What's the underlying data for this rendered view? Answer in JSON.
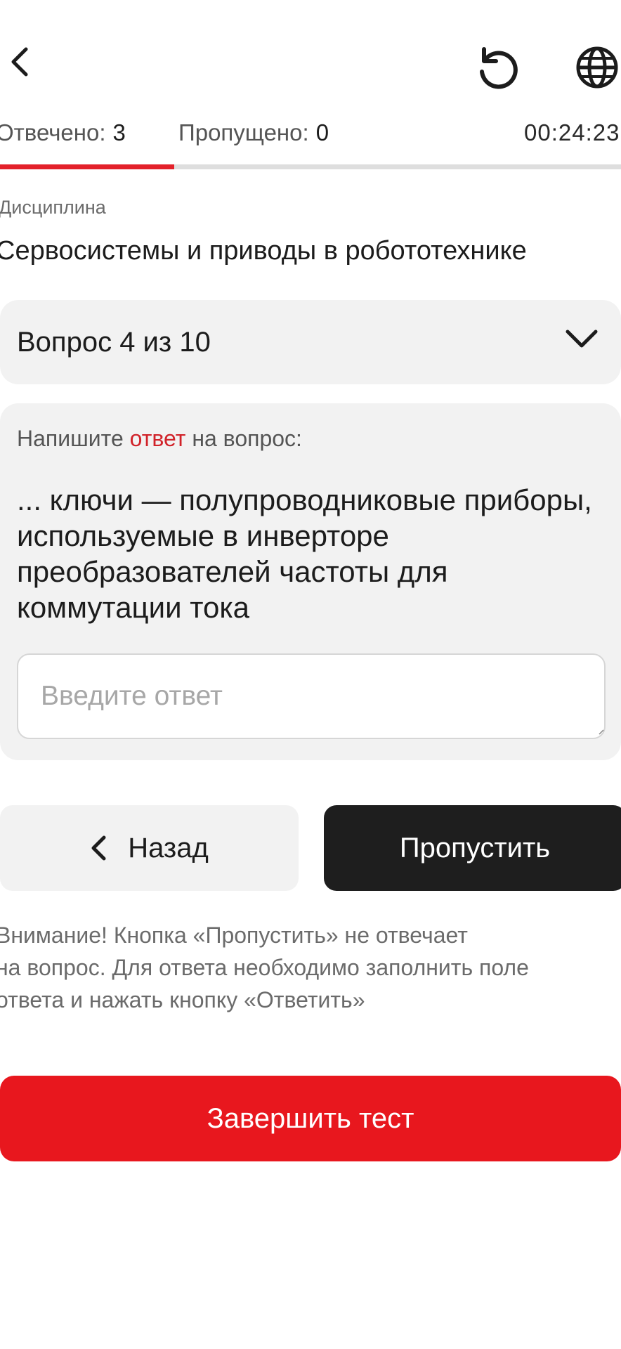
{
  "header": {
    "back_icon": "chevron-left-icon",
    "reset_icon": "reset-icon",
    "language_icon": "globe-icon"
  },
  "stats": {
    "answered_label": "Отвечено:",
    "answered_value": "3",
    "skipped_label": "Пропущено:",
    "skipped_value": "0",
    "timer": "00:24:23",
    "progress_fraction": 0.28
  },
  "discipline": {
    "label": "Дисциплина",
    "title": "Сервосистемы и приводы в робототехнике"
  },
  "question_selector": {
    "label": "Вопрос 4 из 10",
    "icon": "chevron-down-icon"
  },
  "question": {
    "prompt_before": "Напишите ",
    "prompt_accent": "ответ",
    "prompt_after": " на вопрос:",
    "text": "... ключи — полупроводниковые приборы, используемые в инверторе преобразователей частоты для коммутации тока",
    "answer_value": "",
    "answer_placeholder": "Введите ответ"
  },
  "buttons": {
    "back_label": "Назад",
    "skip_label": "Пропустить",
    "finish_label": "Завершить тест"
  },
  "warning": {
    "line1": "Внимание! Кнопка «Пропустить» не отвечает",
    "line2": "на вопрос. Для ответа необходимо заполнить поле",
    "line3": "ответа и нажать кнопку «Ответить»"
  },
  "colors": {
    "accent": "#e3212a",
    "finish_button": "#e8171e",
    "skip_button": "#1e1e1e",
    "card_background": "#f2f2f2"
  }
}
